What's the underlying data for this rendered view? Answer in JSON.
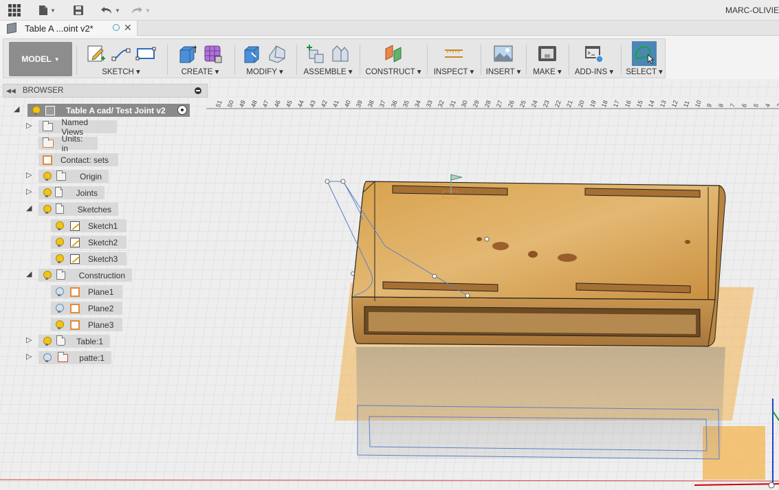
{
  "topbar": {
    "apps_icon": "grid-icon",
    "file_icon": "file-icon",
    "save_icon": "save-icon",
    "undo_icon": "undo-icon",
    "redo_icon": "redo-icon",
    "user": "MARC-OLIVIE"
  },
  "tab": {
    "title": "Table A ...oint v2*"
  },
  "ribbon": {
    "workspace": "MODEL",
    "groups": [
      {
        "label": "SKETCH"
      },
      {
        "label": "CREATE"
      },
      {
        "label": "MODIFY"
      },
      {
        "label": "ASSEMBLE"
      },
      {
        "label": "CONSTRUCT"
      },
      {
        "label": "INSPECT"
      },
      {
        "label": "INSERT"
      },
      {
        "label": "MAKE"
      },
      {
        "label": "ADD-INS"
      },
      {
        "label": "SELECT"
      }
    ]
  },
  "browser": {
    "title": "BROWSER",
    "root": "Table A cad/ Test Joint v2",
    "items": [
      {
        "label": "Named Views"
      },
      {
        "label": "Units: in"
      },
      {
        "label": "Contact: sets"
      },
      {
        "label": "Origin"
      },
      {
        "label": "Joints"
      },
      {
        "label": "Sketches"
      },
      {
        "label": "Sketch1"
      },
      {
        "label": "Sketch2"
      },
      {
        "label": "Sketch3"
      },
      {
        "label": "Construction"
      },
      {
        "label": "Plane1"
      },
      {
        "label": "Plane2"
      },
      {
        "label": "Plane3"
      },
      {
        "label": "Table:1"
      },
      {
        "label": "patte:1"
      }
    ]
  },
  "ruler": {
    "ticks": [
      "51",
      "50",
      "49",
      "48",
      "47",
      "46",
      "45",
      "44",
      "43",
      "42",
      "41",
      "40",
      "39",
      "38",
      "37",
      "36",
      "35",
      "34",
      "33",
      "32",
      "31",
      "30",
      "29",
      "28",
      "27",
      "26",
      "25",
      "24",
      "23",
      "22",
      "21",
      "20",
      "19",
      "18",
      "17",
      "16",
      "15",
      "14",
      "13",
      "12",
      "11",
      "10",
      "9",
      "8",
      "7",
      "6",
      "5",
      "4",
      "3"
    ]
  },
  "colors": {
    "wood": "#d9a95a",
    "plane": "#f5c070",
    "sketch_line": "#5b7fc7",
    "ribbon_bg": "#e6e6e6",
    "select_accent": "#4b86b4"
  }
}
